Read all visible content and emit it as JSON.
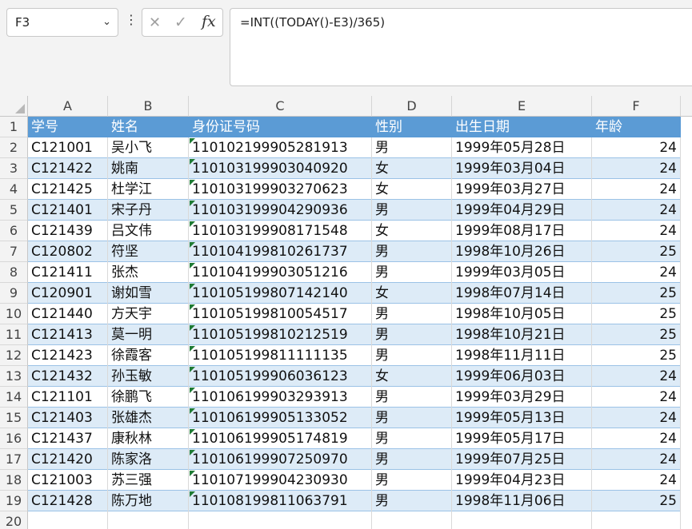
{
  "namebox": {
    "value": "F3"
  },
  "formula_bar": {
    "value": "=INT((TODAY()-E3)/365)"
  },
  "columns": [
    "A",
    "B",
    "C",
    "D",
    "E",
    "F"
  ],
  "header": [
    "学号",
    "姓名",
    "身份证号码",
    "性别",
    "出生日期",
    "年龄"
  ],
  "rows": [
    [
      "C121001",
      "吴小飞",
      "110102199905281913",
      "男",
      "1999年05月28日",
      "24"
    ],
    [
      "C121422",
      "姚南",
      "110103199903040920",
      "女",
      "1999年03月04日",
      "24"
    ],
    [
      "C121425",
      "杜学江",
      "110103199903270623",
      "女",
      "1999年03月27日",
      "24"
    ],
    [
      "C121401",
      "宋子丹",
      "110103199904290936",
      "男",
      "1999年04月29日",
      "24"
    ],
    [
      "C121439",
      "吕文伟",
      "110103199908171548",
      "女",
      "1999年08月17日",
      "24"
    ],
    [
      "C120802",
      "符坚",
      "110104199810261737",
      "男",
      "1998年10月26日",
      "25"
    ],
    [
      "C121411",
      "张杰",
      "110104199903051216",
      "男",
      "1999年03月05日",
      "24"
    ],
    [
      "C120901",
      "谢如雪",
      "110105199807142140",
      "女",
      "1998年07月14日",
      "25"
    ],
    [
      "C121440",
      "方天宇",
      "110105199810054517",
      "男",
      "1998年10月05日",
      "25"
    ],
    [
      "C121413",
      "莫一明",
      "110105199810212519",
      "男",
      "1998年10月21日",
      "25"
    ],
    [
      "C121423",
      "徐霞客",
      "110105199811111135",
      "男",
      "1998年11月11日",
      "25"
    ],
    [
      "C121432",
      "孙玉敏",
      "110105199906036123",
      "女",
      "1999年06月03日",
      "24"
    ],
    [
      "C121101",
      "徐鹏飞",
      "110106199903293913",
      "男",
      "1999年03月29日",
      "24"
    ],
    [
      "C121403",
      "张雄杰",
      "110106199905133052",
      "男",
      "1999年05月13日",
      "24"
    ],
    [
      "C121437",
      "康秋林",
      "110106199905174819",
      "男",
      "1999年05月17日",
      "24"
    ],
    [
      "C121420",
      "陈家洛",
      "110106199907250970",
      "男",
      "1999年07月25日",
      "24"
    ],
    [
      "C121003",
      "苏三强",
      "110107199904230930",
      "男",
      "1999年04月23日",
      "24"
    ],
    [
      "C121428",
      "陈万地",
      "110108199811063791",
      "男",
      "1998年11月06日",
      "25"
    ]
  ],
  "row_numbers": [
    "1",
    "2",
    "3",
    "4",
    "5",
    "6",
    "7",
    "8",
    "9",
    "10",
    "11",
    "12",
    "13",
    "14",
    "15",
    "16",
    "17",
    "18",
    "19",
    "20"
  ],
  "colors": {
    "header_fill": "#5b9bd5",
    "band_fill": "#ddebf7",
    "error_marker": "#1e7b34"
  }
}
